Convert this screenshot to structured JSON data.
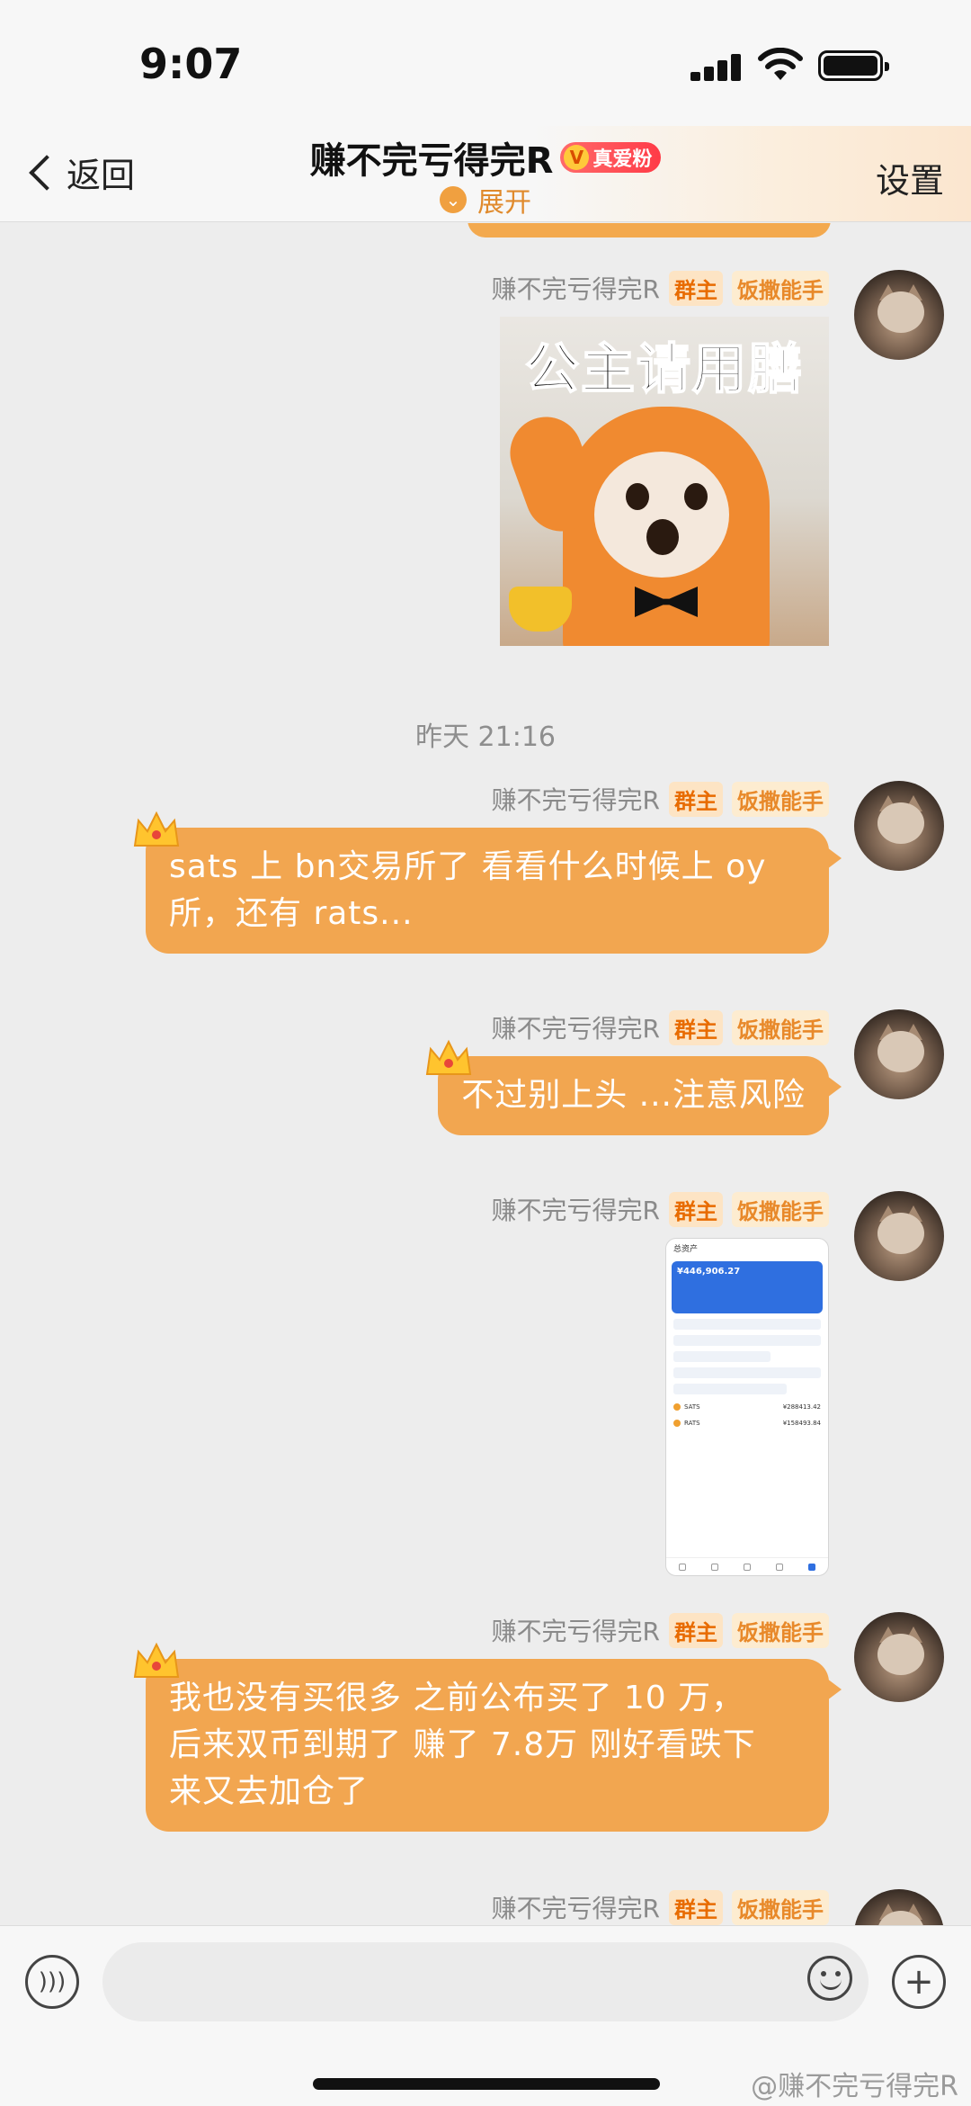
{
  "status_bar": {
    "time": "9:07"
  },
  "nav": {
    "back_label": "返回",
    "title": "赚不完亏得完R",
    "fan_badge": "真爱粉",
    "expand_label": "展开",
    "settings_label": "设置"
  },
  "timestamp": "昨天 21:16",
  "sender": {
    "name": "赚不完亏得完R",
    "tag_owner": "群主",
    "tag_title": "饭撒能手"
  },
  "messages": [
    {
      "type": "sticker",
      "caption": "公主请用膳"
    },
    {
      "type": "text",
      "text_line1": "sats 上 bn交易所了 看看什么时候上 oy",
      "text_line2": "所，还有 rats..."
    },
    {
      "type": "text",
      "text": "不过别上头 ...注意风险"
    },
    {
      "type": "image",
      "title": "总资产",
      "balance": "¥446,906.27",
      "coin1": "SATS",
      "coin1_value": "¥288413.42",
      "coin2": "RATS",
      "coin2_value": "¥158493.84"
    },
    {
      "type": "text",
      "text_line1": "我也没有买很多 之前公布买了 10 万，",
      "text_line2": "后来双币到期了 赚了 7.8万 刚好看跌下",
      "text_line3": "来又去加仓了"
    }
  ],
  "watermark": "@赚不完亏得完R",
  "icons": {
    "back": "chevron-left-icon",
    "voice": "voice-icon",
    "emoji": "emoji-icon",
    "plus": "plus-icon",
    "crown": "crown-icon",
    "expand": "chevron-down-circle-icon"
  },
  "colors": {
    "bubble": "#f2a650",
    "accent": "#e08a2c",
    "owner_tag": "#e86b00"
  }
}
